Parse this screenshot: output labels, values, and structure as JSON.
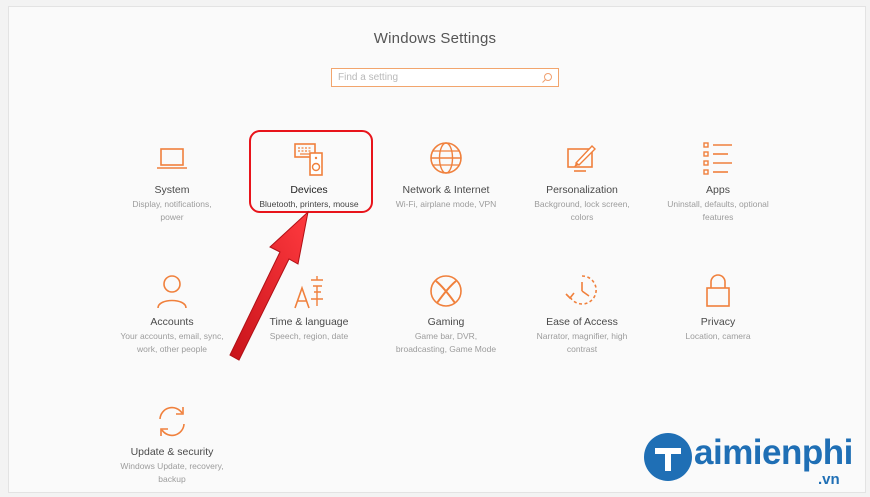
{
  "window": {
    "title": "Windows Settings"
  },
  "search": {
    "placeholder": "Find a setting"
  },
  "tiles": [
    {
      "name": "System",
      "desc": [
        "Display, notifications,",
        "power"
      ],
      "icon": "laptop-icon"
    },
    {
      "name": "Devices",
      "desc": [
        "Bluetooth, printers, mouse"
      ],
      "icon": "devices-icon"
    },
    {
      "name": "Network & Internet",
      "desc": [
        "Wi-Fi, airplane mode, VPN"
      ],
      "icon": "globe-icon"
    },
    {
      "name": "Personalization",
      "desc": [
        "Background, lock screen,",
        "colors"
      ],
      "icon": "paint-icon"
    },
    {
      "name": "Apps",
      "desc": [
        "Uninstall, defaults, optional",
        "features"
      ],
      "icon": "apps-list-icon"
    },
    {
      "name": "Accounts",
      "desc": [
        "Your accounts, email, sync,",
        "work, other people"
      ],
      "icon": "person-icon"
    },
    {
      "name": "Time & language",
      "desc": [
        "Speech, region, date"
      ],
      "icon": "time-language-icon"
    },
    {
      "name": "Gaming",
      "desc": [
        "Game bar, DVR,",
        "broadcasting, Game Mode"
      ],
      "icon": "xbox-icon"
    },
    {
      "name": "Ease of Access",
      "desc": [
        "Narrator, magnifier, high",
        "contrast"
      ],
      "icon": "ease-of-access-icon"
    },
    {
      "name": "Privacy",
      "desc": [
        "Location, camera"
      ],
      "icon": "lock-icon"
    },
    {
      "name": "Update & security",
      "desc": [
        "Windows Update, recovery,",
        "backup"
      ],
      "icon": "sync-icon"
    }
  ],
  "colors": {
    "accent": "#f0803c",
    "highlight": "#e8141b",
    "watermark": "#1f6fb5"
  },
  "watermark": {
    "brand": "aimienphi",
    "tld": ".vn"
  }
}
